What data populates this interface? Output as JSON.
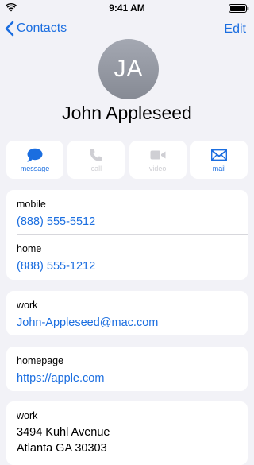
{
  "status_bar": {
    "time": "9:41 AM"
  },
  "nav": {
    "back_label": "Contacts",
    "edit_label": "Edit"
  },
  "contact": {
    "initials": "JA",
    "name": "John Appleseed"
  },
  "actions": [
    {
      "label": "message",
      "icon": "message-icon",
      "enabled": true
    },
    {
      "label": "call",
      "icon": "phone-icon",
      "enabled": false
    },
    {
      "label": "video",
      "icon": "video-icon",
      "enabled": false
    },
    {
      "label": "mail",
      "icon": "mail-icon",
      "enabled": true
    }
  ],
  "phones": [
    {
      "label": "mobile",
      "value": "(888) 555-5512"
    },
    {
      "label": "home",
      "value": "(888) 555-1212"
    }
  ],
  "email": {
    "label": "work",
    "value": "John-Appleseed@mac.com"
  },
  "homepage": {
    "label": "homepage",
    "value": "https://apple.com"
  },
  "address": {
    "label": "work",
    "line1": "3494 Kuhl Avenue",
    "line2": "Atlanta GA 30303"
  },
  "colors": {
    "accent": "#1b6ee0",
    "background": "#f2f2f7",
    "disabled": "#cfcfd4"
  }
}
